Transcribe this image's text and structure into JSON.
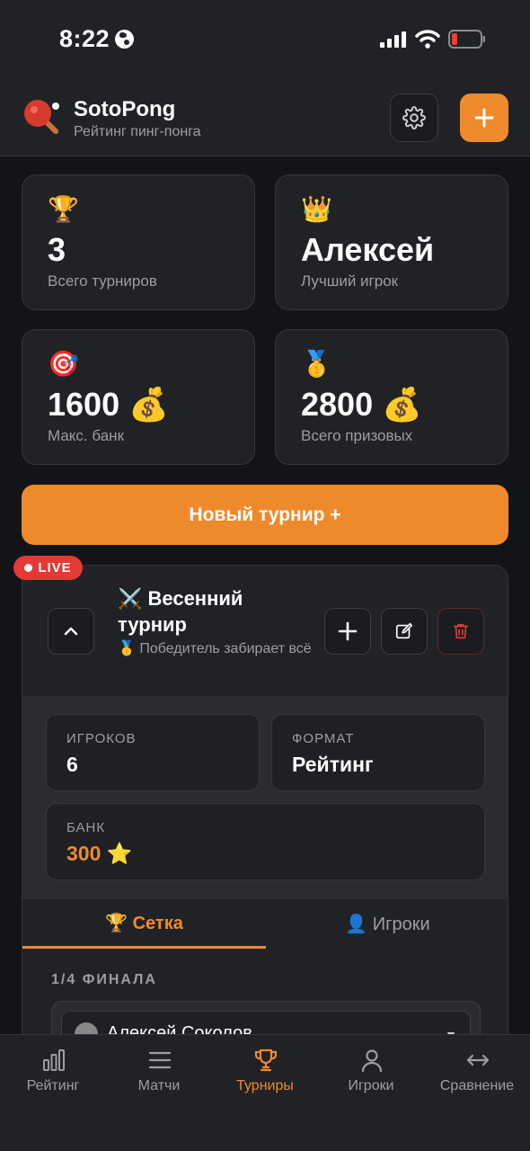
{
  "status_bar": {
    "time": "8:22"
  },
  "header": {
    "title": "SotoPong",
    "subtitle": "Рейтинг пинг-понга"
  },
  "stats": [
    {
      "emoji": "🏆",
      "value": "3",
      "label": "Всего турниров"
    },
    {
      "emoji": "👑",
      "value": "Алексей",
      "label": "Лучший игрок"
    },
    {
      "emoji": "🎯",
      "value": "1600 💰",
      "label": "Макс. банк"
    },
    {
      "emoji": "🥇",
      "value": "2800 💰",
      "label": "Всего призовых"
    }
  ],
  "new_tournament_label": "Новый турнир +",
  "tournament": {
    "live_label": "LIVE",
    "title": "⚔️ Весенний турнир",
    "subtitle": "🥇 Победитель забирает всё",
    "players_label": "ИГРОКОВ",
    "players_value": "6",
    "format_label": "ФОРМАТ",
    "format_value": "Рейтинг",
    "bank_label": "БАНК",
    "bank_value": "300 ⭐",
    "tabs": [
      {
        "label": "🏆 Сетка",
        "active": true
      },
      {
        "label": "👤 Игроки",
        "active": false
      }
    ],
    "round_label": "1/4 ФИНАЛА",
    "first_player": "Алексей Соколов"
  },
  "bottom_nav": [
    {
      "label": "Рейтинг",
      "icon": "bar-chart-icon",
      "active": false
    },
    {
      "label": "Матчи",
      "icon": "menu-icon",
      "active": false
    },
    {
      "label": "Турниры",
      "icon": "trophy-icon",
      "active": true
    },
    {
      "label": "Игроки",
      "icon": "user-icon",
      "active": false
    },
    {
      "label": "Сравнение",
      "icon": "compare-arrows-icon",
      "active": false
    }
  ],
  "colors": {
    "accent": "#ef8a2c",
    "live": "#e53935",
    "background": "#131418",
    "card": "#202226"
  }
}
